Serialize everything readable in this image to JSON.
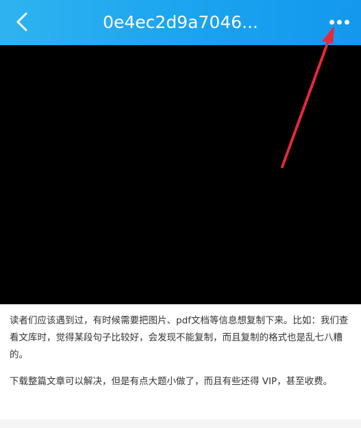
{
  "header": {
    "title": "0e4ec2d9a7046...",
    "back_icon": "chevron-left-icon",
    "more_icon": "more-dots-icon"
  },
  "colors": {
    "header_start": "#2fb3f0",
    "header_end": "#1398ee",
    "arrow": "#e8283a",
    "preview_bg": "#000000"
  },
  "article": {
    "paragraphs": [
      "读者们应该遇到过，有时候需要把图片、pdf文档等信息想复制下来。比如：我们查看文库时，觉得某段句子比较好，会发现不能复制，而且复制的格式也是乱七八糟的。",
      "下载整篇文章可以解决，但是有点大题小做了，而且有些还得 VIP，甚至收费。"
    ]
  }
}
